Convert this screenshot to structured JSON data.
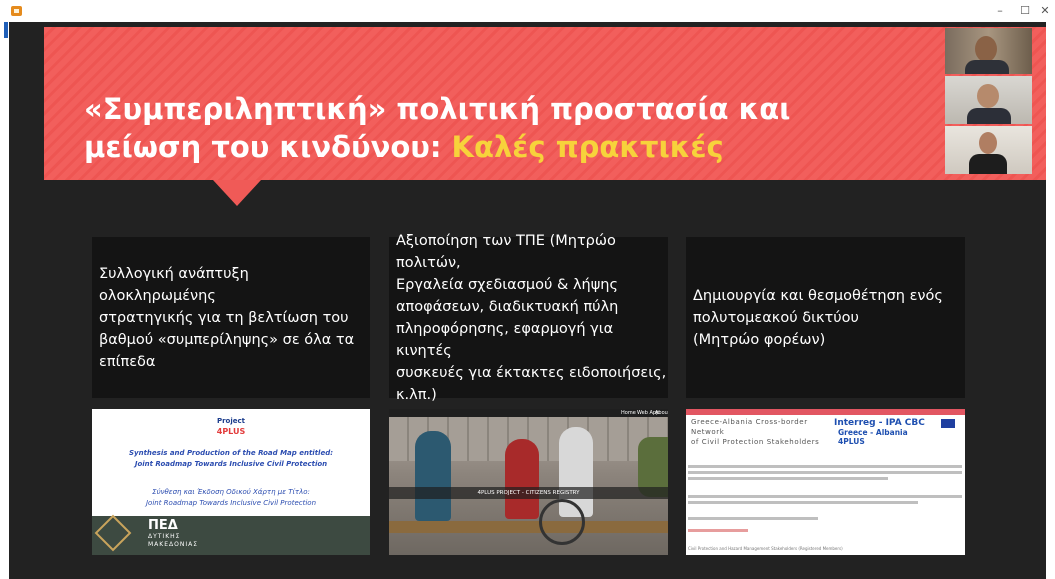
{
  "window": {
    "controls": {
      "minimize": "–",
      "maximize": "☐",
      "close": "✕"
    }
  },
  "slide": {
    "title_line1": "«Συμπεριληπτική» πολιτική προστασία και",
    "title_line2": "μείωση του κινδύνου: ",
    "title_highlight": "Καλές πρακτικές",
    "colors": {
      "banner": "#f25f5c",
      "highlight": "#f7d23b",
      "background": "#222222",
      "box": "#141414"
    },
    "boxes": [
      {
        "lines": [
          "Συλλογική ανάπτυξη ολοκληρωμένης",
          "στρατηγικής για τη βελτίωση του",
          "βαθμού «συμπερίληψης» σε όλα τα",
          "επίπεδα"
        ]
      },
      {
        "lines": [
          "Αξιοποίηση των ΤΠΕ (Μητρώο πολιτών,",
          "Εργαλεία σχεδιασμού & λήψης",
          "αποφάσεων, διαδικτυακή πύλη",
          "πληροφόρησης, εφαρμογή για κινητές",
          "συσκευές για έκτακτες ειδοποιήσεις,",
          "κ.λπ.)"
        ]
      },
      {
        "lines": [
          "Δημιουργία και θεσμοθέτηση ενός",
          "πολυτομεακού δικτύου",
          "(Μητρώο φορέων)"
        ]
      }
    ],
    "thumb1": {
      "project_label": "Project",
      "project_name": "4PLUS",
      "en_line1": "Synthesis and Production of the Road Map entitled:",
      "en_line2": "Joint Roadmap Towards Inclusive Civil Protection",
      "gr_line1": "Σύνθεση και Έκδοση Οδικού Χάρτη με Τίτλο:",
      "gr_line2": "Joint Roadmap Towards Inclusive Civil Protection",
      "logo_big": "ΠΕΔ",
      "logo_sub1": "ΔΥΤΙΚΗΣ",
      "logo_sub2": "ΜΑΚΕΔΟΝΙΑΣ"
    },
    "thumb2": {
      "nav": [
        "Home",
        "Web App",
        "About"
      ],
      "caption": "4PLUS PROJECT - CITIZENS REGISTRY"
    },
    "thumb3": {
      "heading1": "Greece-Albania Cross-border",
      "heading2": "Network",
      "heading3": "of Civil Protection Stakeholders",
      "brand1": "Interreg - IPA CBC",
      "brand2": "Greece - Albania",
      "brand3": "4PLUS",
      "footer": "Civil Protection and Hazard Management Stakeholders (Registered Members)"
    }
  }
}
